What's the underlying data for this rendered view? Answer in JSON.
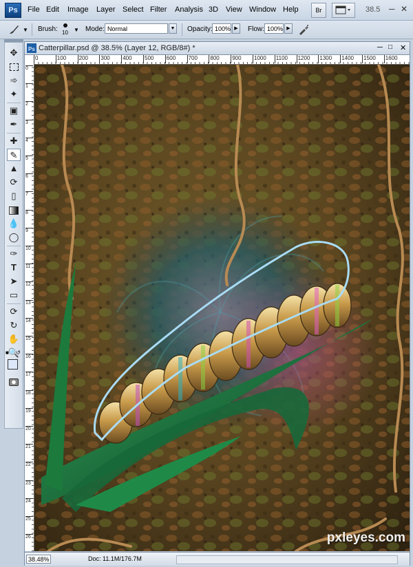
{
  "app": {
    "logo": "Ps",
    "menu": [
      "File",
      "Edit",
      "Image",
      "Layer",
      "Select",
      "Filter",
      "Analysis",
      "3D",
      "View",
      "Window",
      "Help"
    ],
    "bridge_label": "Br",
    "zoom_readout": "38.5"
  },
  "options_bar": {
    "brush_label": "Brush:",
    "brush_size": "10",
    "mode_label": "Mode:",
    "mode_value": "Normal",
    "opacity_label": "Opacity:",
    "opacity_value": "100%",
    "flow_label": "Flow:",
    "flow_value": "100%"
  },
  "document": {
    "title": "Catterpillar.psd @ 38.5% (Layer 12, RGB/8#) *",
    "ruler_top": [
      "0",
      "100",
      "200",
      "300",
      "400",
      "500",
      "600",
      "700",
      "800",
      "900",
      "1000",
      "1100",
      "1200",
      "1300",
      "1400",
      "1500",
      "1600"
    ],
    "ruler_left": [
      "0",
      "1",
      "2",
      "3",
      "4",
      "5",
      "6",
      "7",
      "8",
      "9",
      "10",
      "11",
      "12",
      "13",
      "14",
      "15",
      "16",
      "17",
      "18",
      "19",
      "20",
      "21",
      "22",
      "23",
      "24",
      "25",
      "26"
    ],
    "zoom": "38.48%",
    "doc_size": "Doc: 11.1M/176.7M"
  },
  "watermark": "pxleyes.com",
  "colors": {
    "foreground": "#dce8fa",
    "background": "#ffffff",
    "selection_path": "#a9dcf5"
  }
}
